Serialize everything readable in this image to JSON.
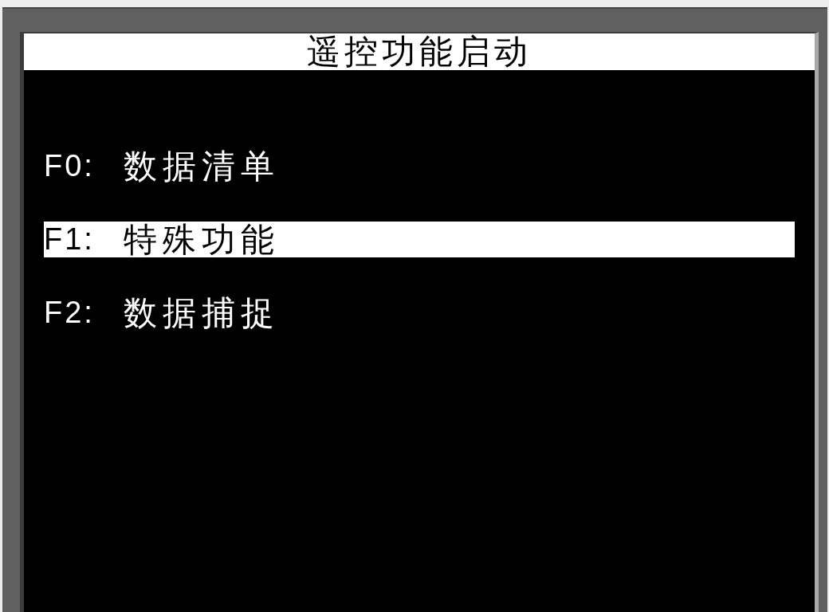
{
  "screen": {
    "title": "遥控功能启动"
  },
  "menu": {
    "items": [
      {
        "key": "F0:",
        "label": "数据清单",
        "selected": false
      },
      {
        "key": "F1:",
        "label": "特殊功能",
        "selected": true
      },
      {
        "key": "F2:",
        "label": "数据捕捉",
        "selected": false
      }
    ]
  }
}
